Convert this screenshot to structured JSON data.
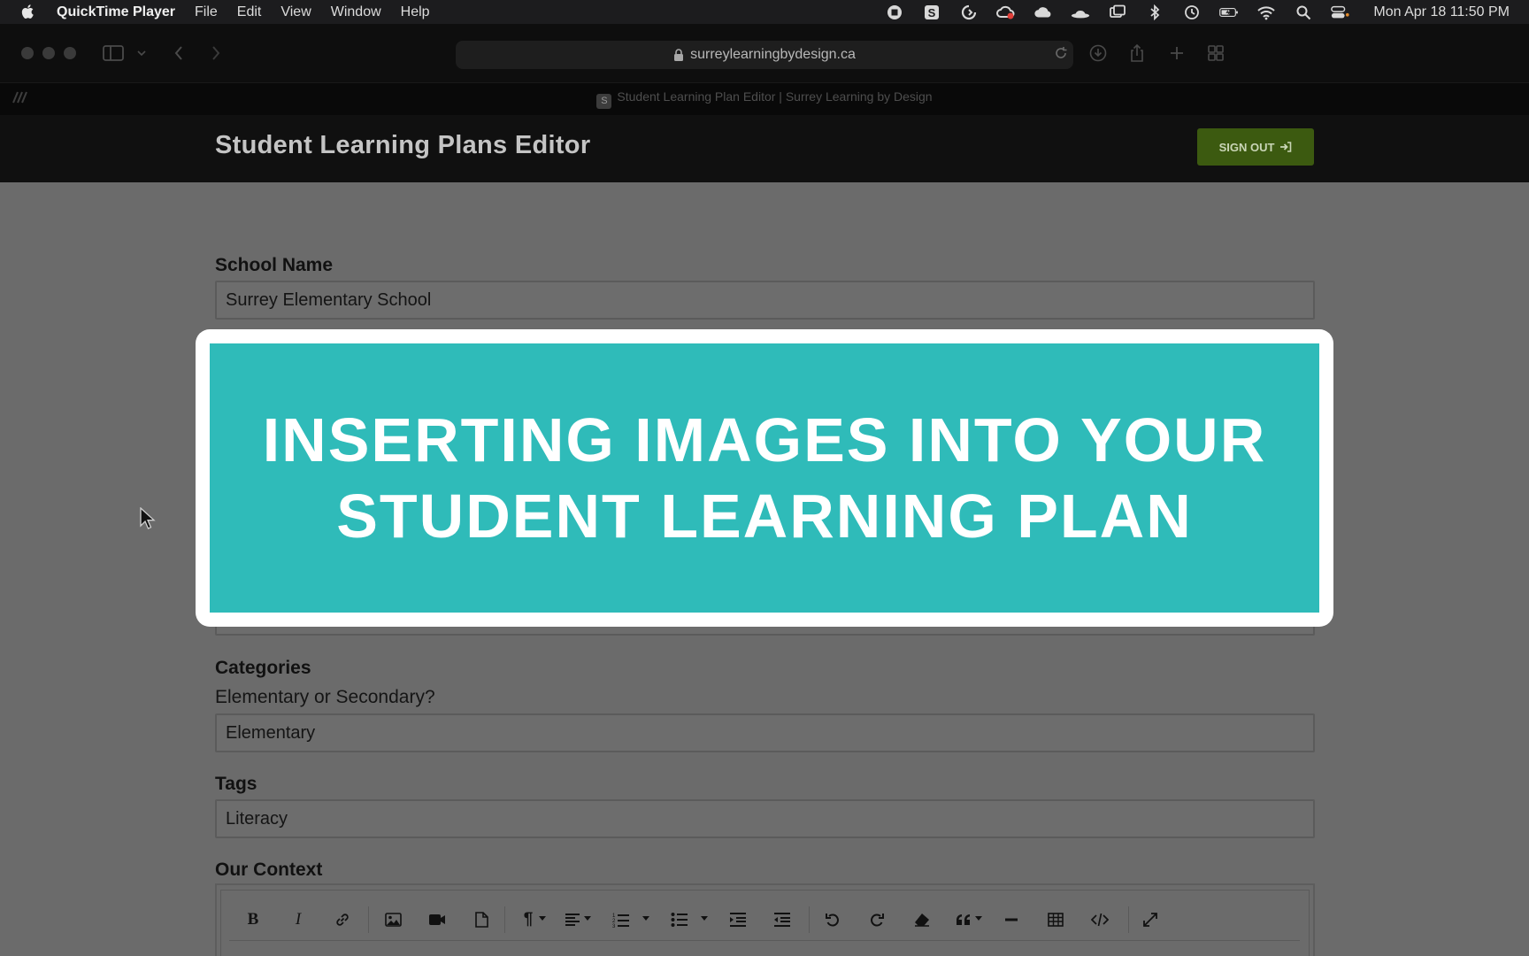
{
  "menubar": {
    "app_name": "QuickTime Player",
    "menus": [
      "File",
      "Edit",
      "View",
      "Window",
      "Help"
    ],
    "clock": "Mon Apr 18  11:50 PM",
    "status_icons": [
      "screen-record-icon",
      "s-badge-icon",
      "clockwise-icon",
      "creative-cloud-icon",
      "cloud-icon",
      "bowler-hat-icon",
      "screen-mirroring-icon",
      "bluetooth-icon",
      "time-machine-icon",
      "battery-icon",
      "wifi-icon",
      "spotlight-search-icon",
      "control-center-icon"
    ]
  },
  "browser": {
    "url": "surreylearningbydesign.ca",
    "tab_title": "Student Learning Plan Editor | Surrey Learning by Design",
    "tab_favicon": "S"
  },
  "header": {
    "title": "Student Learning Plans Editor",
    "signout_label": "SIGN OUT"
  },
  "form": {
    "school_label": "School Name",
    "school_value": "Surrey Elementary School",
    "categories_label": "Categories",
    "categories_sub": "Elementary or Secondary?",
    "categories_value": "Elementary",
    "tags_label": "Tags",
    "tags_value": "Literacy",
    "context_label": "Our Context"
  },
  "editor_toolbar": {
    "bold": "B",
    "italic": "I",
    "tools": [
      "bold-icon",
      "italic-icon",
      "link-icon",
      "image-icon",
      "video-icon",
      "file-icon",
      "paragraph-icon",
      "align-icon",
      "ordered-list-icon",
      "unordered-list-icon",
      "indent-icon",
      "outdent-icon",
      "undo-icon",
      "redo-icon",
      "clear-format-icon",
      "quote-icon",
      "horizontal-rule-icon",
      "table-icon",
      "code-view-icon",
      "fullscreen-icon"
    ]
  },
  "overlay": {
    "line1": "INSERTING IMAGES INTO YOUR",
    "line2": "STUDENT LEARNING PLAN",
    "background": "#2fbbb9",
    "frame": "#ffffff"
  },
  "colors": {
    "signout_button": "#3c5a10",
    "page_background": "#6b6b6b"
  }
}
